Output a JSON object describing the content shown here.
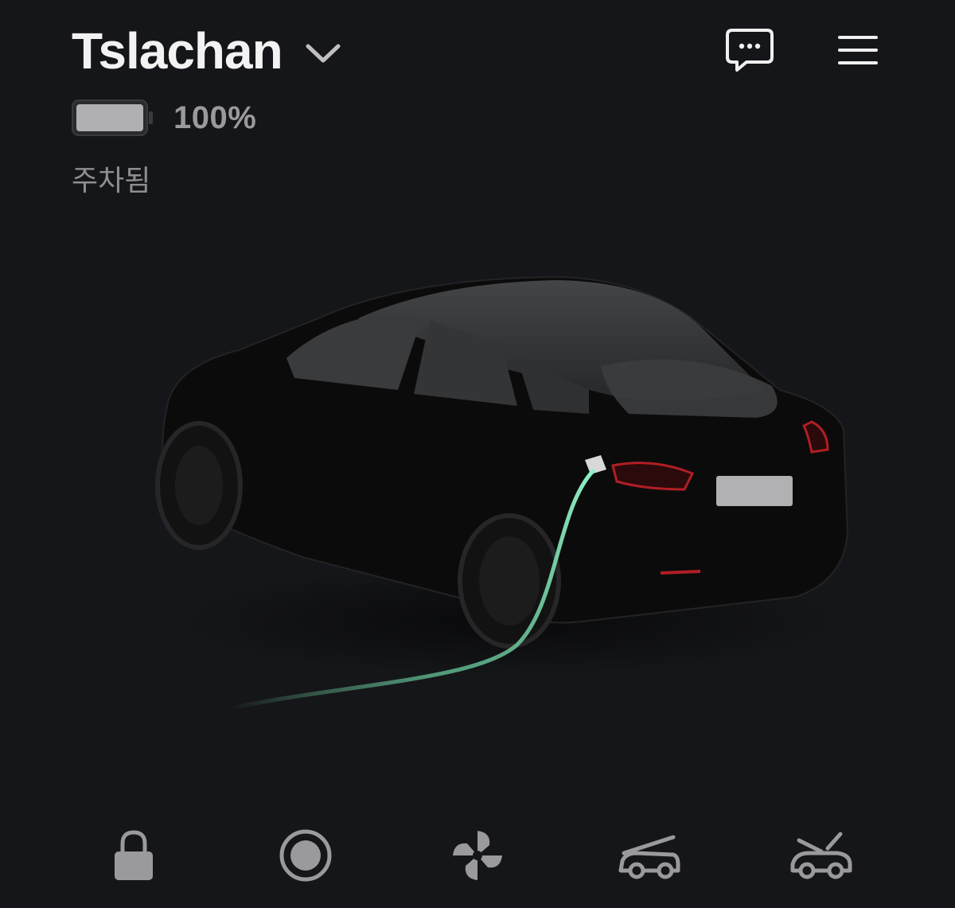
{
  "header": {
    "car_name": "Tslachan",
    "battery_percent_label": "100%",
    "battery_level": 1.0,
    "status": "주차됨"
  },
  "icons": {
    "dropdown": "chevron-down-icon",
    "messages": "chat-bubble-icon",
    "menu": "hamburger-menu-icon"
  },
  "bottom_controls": [
    {
      "icon": "lock-icon"
    },
    {
      "icon": "sentry-mode-icon"
    },
    {
      "icon": "fan-climate-icon"
    },
    {
      "icon": "frunk-icon"
    },
    {
      "icon": "trunk-icon"
    }
  ],
  "colors": {
    "background": "#151619",
    "charging_cable": "#7fe0b0",
    "icon_gray": "#9a9a9c"
  }
}
